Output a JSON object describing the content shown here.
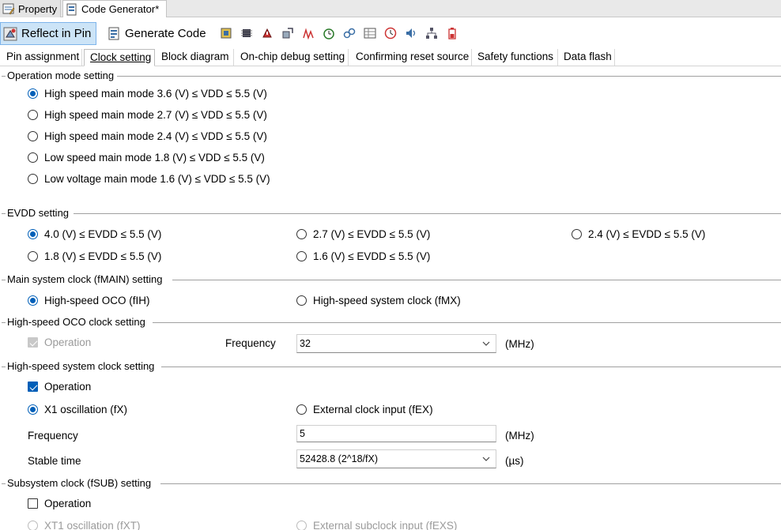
{
  "doc_tabs": [
    {
      "label": "Property"
    },
    {
      "label": "Code Generator*"
    }
  ],
  "toolbar": {
    "reflect_label": "Reflect in Pin",
    "generate_label": "Generate Code"
  },
  "subtabs": [
    "Pin assignment",
    "Clock setting",
    "Block diagram",
    "On-chip debug setting",
    "Confirming reset source",
    "Safety functions",
    "Data flash"
  ],
  "operation_mode": {
    "title": "Operation mode setting",
    "options": [
      "High speed main mode 3.6 (V) ≤ VDD ≤ 5.5 (V)",
      "High speed main mode 2.7 (V) ≤ VDD ≤ 5.5 (V)",
      "High speed main mode 2.4 (V) ≤ VDD ≤ 5.5 (V)",
      "Low speed main mode 1.8 (V) ≤ VDD ≤ 5.5 (V)",
      "Low voltage main mode 1.6 (V) ≤ VDD ≤ 5.5 (V)"
    ],
    "selected": 0
  },
  "evdd": {
    "title": "EVDD setting",
    "options": [
      "4.0 (V) ≤ EVDD ≤ 5.5 (V)",
      "2.7 (V) ≤ EVDD ≤ 5.5 (V)",
      "2.4 (V) ≤ EVDD ≤ 5.5 (V)",
      "1.8 (V) ≤ EVDD ≤ 5.5 (V)",
      "1.6 (V) ≤ EVDD ≤ 5.5 (V)"
    ],
    "selected": 0
  },
  "main_clock": {
    "title": "Main system clock (fMAIN) setting",
    "options": [
      "High-speed OCO (fIH)",
      "High-speed system clock (fMX)"
    ],
    "selected": 0
  },
  "oco": {
    "title": "High-speed OCO clock setting",
    "operation_label": "Operation",
    "operation_checked": true,
    "operation_enabled": false,
    "frequency_label": "Frequency",
    "frequency_value": "32",
    "unit": "(MHz)"
  },
  "hs_system": {
    "title": "High-speed system clock setting",
    "operation_label": "Operation",
    "operation_checked": true,
    "options": [
      "X1 oscillation (fX)",
      "External clock input (fEX)"
    ],
    "selected": 0,
    "frequency_label": "Frequency",
    "frequency_value": "5",
    "frequency_unit": "(MHz)",
    "stable_label": "Stable time",
    "stable_value": "52428.8 (2^18/fX)",
    "stable_unit": "(µs)"
  },
  "subsystem": {
    "title": "Subsystem clock (fSUB) setting",
    "operation_label": "Operation",
    "operation_checked": false,
    "options": [
      "XT1 oscillation (fXT)",
      "External subclock input (fEXS)"
    ]
  },
  "colors": {
    "accent": "#005fb8",
    "pressed_bg": "#cce4f7"
  }
}
